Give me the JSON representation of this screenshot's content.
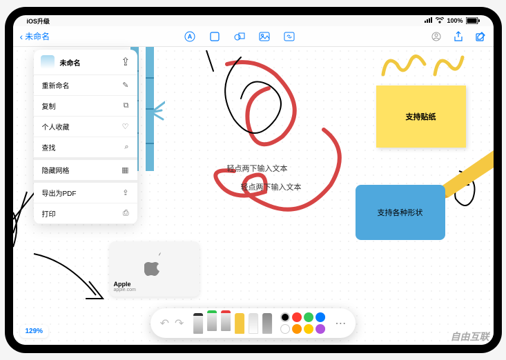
{
  "status": {
    "left_text": "iOS升级",
    "battery": "100%"
  },
  "toolbar": {
    "back_label": "未命名"
  },
  "dropdown": {
    "title": "未命名",
    "items": [
      {
        "label": "重新命名",
        "icon": "✎"
      },
      {
        "label": "复制",
        "icon": "⧉"
      },
      {
        "label": "个人收藏",
        "icon": "♡"
      },
      {
        "label": "查找",
        "icon": "⌕"
      },
      {
        "label": "隐藏网格",
        "icon": "▦"
      },
      {
        "label": "导出为PDF",
        "icon": "⇪"
      },
      {
        "label": "打印",
        "icon": "⎙"
      }
    ]
  },
  "canvas": {
    "sticky_label": "支持贴纸",
    "shape_label": "支持各种形状",
    "text_hint_1": "轻点两下输入文本",
    "text_hint_2": "轻点两下输入文本",
    "apple_card_title": "Apple",
    "apple_card_sub": "apple.com"
  },
  "zoom": "129%",
  "watermark": "自由互联"
}
